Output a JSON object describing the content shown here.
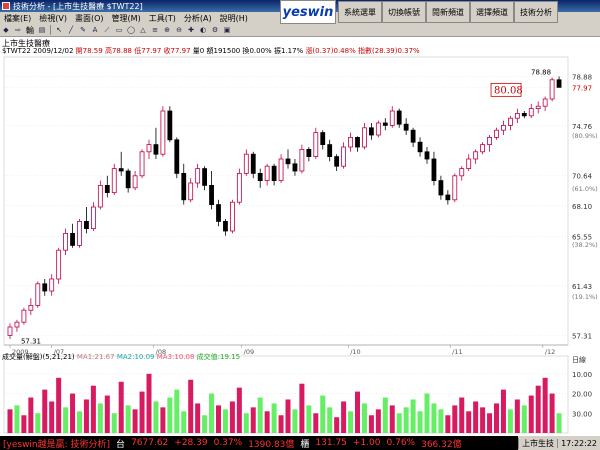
{
  "window": {
    "title": "技術分析 - [上市生技醫療 $TWT22]"
  },
  "menu": [
    "檔案(E)",
    "檢視(V)",
    "畫面(O)",
    "管理(M)",
    "工具(T)",
    "分析(A)",
    "說明(H)"
  ],
  "brand": "yeswin",
  "nav_buttons": [
    "系統選單",
    "切換帳號",
    "閱新頻道",
    "選擇頻道",
    "技術分析"
  ],
  "toolbar": {
    "zoom_label": "輸"
  },
  "stock": {
    "name": "上市生技醫療",
    "code": "$TWT22",
    "date": "2009/12/02",
    "open": "開78.59",
    "high": "高78.88",
    "low": "低77.97",
    "close": "收77.97",
    "volume": "量0",
    "amount": "額191500",
    "turnover": "換0.00%",
    "amplitude": "振1.17%",
    "change": "漲(0.37)0.48%",
    "index": "指數(28.39)0.37%"
  },
  "chart_data": {
    "type": "candlestick",
    "ylim": [
      56.5,
      80.5
    ],
    "y_ticks": [
      78.88,
      77.97,
      74.76,
      70.64,
      68.1,
      65.55,
      61.43,
      57.31
    ],
    "y_tick_labels": [
      "78.88",
      "77.97",
      "74.76",
      "70.64",
      "68.10",
      "65.55",
      "61.43",
      "57.31"
    ],
    "pct_labels": [
      {
        "v": 74.0,
        "t": "(80.9%)"
      },
      {
        "v": 69.6,
        "t": "(61.0%)"
      },
      {
        "v": 64.9,
        "t": "(38.2%)"
      },
      {
        "v": 60.6,
        "t": "(19.1%)"
      }
    ],
    "x_labels": [
      "2009",
      "/07",
      "/08",
      "/09",
      "/10",
      "/11",
      "/12"
    ],
    "x_positions": [
      0,
      18,
      62,
      100,
      146,
      190,
      230
    ],
    "cursor_value": "80.08",
    "min_label": "57.31",
    "max_label": "78.88",
    "last_price_label": "77.97",
    "candles": [
      [
        57.3,
        58.3,
        57.0,
        58.0
      ],
      [
        58.0,
        58.6,
        57.6,
        58.4
      ],
      [
        58.4,
        59.6,
        58.2,
        59.4
      ],
      [
        59.4,
        60.4,
        59.0,
        59.8
      ],
      [
        59.8,
        61.8,
        59.6,
        61.6
      ],
      [
        61.6,
        62.0,
        60.6,
        61.0
      ],
      [
        61.0,
        62.4,
        60.6,
        62.0
      ],
      [
        62.0,
        64.6,
        61.6,
        64.4
      ],
      [
        64.4,
        66.2,
        64.0,
        65.8
      ],
      [
        65.8,
        66.6,
        64.6,
        64.8
      ],
      [
        64.8,
        67.0,
        64.6,
        66.8
      ],
      [
        66.8,
        68.0,
        65.8,
        66.2
      ],
      [
        66.2,
        68.4,
        66.0,
        68.0
      ],
      [
        68.0,
        70.2,
        67.8,
        69.8
      ],
      [
        69.8,
        70.6,
        68.8,
        69.2
      ],
      [
        69.2,
        71.6,
        69.0,
        71.2
      ],
      [
        71.2,
        72.6,
        70.6,
        71.0
      ],
      [
        71.0,
        71.2,
        69.2,
        69.6
      ],
      [
        69.6,
        71.0,
        69.4,
        70.6
      ],
      [
        70.6,
        72.8,
        70.4,
        72.6
      ],
      [
        72.6,
        73.6,
        72.0,
        73.2
      ],
      [
        73.2,
        74.6,
        72.0,
        72.4
      ],
      [
        72.4,
        76.4,
        72.2,
        76.0
      ],
      [
        76.0,
        76.4,
        73.4,
        73.6
      ],
      [
        73.6,
        73.8,
        70.4,
        70.8
      ],
      [
        70.8,
        71.6,
        68.2,
        68.6
      ],
      [
        68.6,
        70.4,
        68.4,
        70.0
      ],
      [
        70.0,
        71.6,
        69.6,
        71.2
      ],
      [
        71.2,
        71.4,
        69.4,
        69.8
      ],
      [
        69.8,
        71.0,
        67.8,
        68.2
      ],
      [
        68.2,
        68.6,
        66.4,
        66.8
      ],
      [
        66.8,
        67.0,
        65.6,
        66.0
      ],
      [
        66.0,
        68.6,
        65.8,
        68.4
      ],
      [
        68.4,
        71.2,
        68.2,
        70.8
      ],
      [
        70.8,
        72.8,
        70.6,
        72.4
      ],
      [
        72.4,
        72.6,
        70.4,
        70.8
      ],
      [
        70.8,
        71.2,
        69.6,
        70.2
      ],
      [
        70.2,
        71.6,
        69.8,
        71.4
      ],
      [
        71.4,
        71.6,
        69.8,
        70.2
      ],
      [
        70.2,
        72.4,
        70.0,
        72.0
      ],
      [
        72.0,
        72.8,
        71.2,
        71.6
      ],
      [
        71.6,
        72.0,
        70.6,
        71.0
      ],
      [
        71.0,
        73.2,
        70.8,
        72.8
      ],
      [
        72.8,
        73.0,
        71.8,
        72.2
      ],
      [
        72.2,
        74.6,
        72.0,
        74.2
      ],
      [
        74.2,
        74.4,
        72.8,
        73.2
      ],
      [
        73.2,
        73.6,
        71.8,
        72.2
      ],
      [
        72.2,
        72.4,
        71.0,
        71.4
      ],
      [
        71.4,
        73.4,
        71.2,
        73.0
      ],
      [
        73.0,
        74.2,
        72.6,
        73.8
      ],
      [
        73.8,
        73.9,
        72.6,
        73.0
      ],
      [
        73.0,
        75.0,
        72.8,
        74.6
      ],
      [
        74.6,
        75.0,
        73.6,
        74.0
      ],
      [
        74.0,
        75.2,
        73.8,
        75.0
      ],
      [
        75.0,
        75.4,
        74.4,
        74.8
      ],
      [
        74.8,
        76.4,
        74.6,
        76.0
      ],
      [
        76.0,
        76.2,
        74.6,
        74.9
      ],
      [
        74.9,
        75.4,
        74.0,
        74.4
      ],
      [
        74.4,
        74.6,
        73.0,
        73.4
      ],
      [
        73.4,
        73.8,
        72.2,
        72.6
      ],
      [
        72.6,
        73.0,
        71.6,
        72.0
      ],
      [
        72.0,
        72.6,
        69.8,
        70.2
      ],
      [
        70.2,
        70.6,
        68.6,
        69.0
      ],
      [
        69.0,
        69.4,
        68.2,
        68.6
      ],
      [
        68.6,
        70.8,
        68.4,
        70.6
      ],
      [
        70.6,
        71.4,
        70.2,
        71.2
      ],
      [
        71.2,
        72.4,
        71.0,
        72.0
      ],
      [
        72.0,
        72.8,
        71.6,
        72.6
      ],
      [
        72.6,
        73.4,
        72.4,
        73.2
      ],
      [
        73.2,
        74.0,
        72.6,
        73.8
      ],
      [
        73.8,
        74.6,
        73.6,
        74.4
      ],
      [
        74.4,
        75.2,
        74.0,
        74.8
      ],
      [
        74.8,
        75.6,
        74.4,
        75.4
      ],
      [
        75.4,
        76.2,
        75.0,
        75.8
      ],
      [
        75.8,
        76.0,
        75.4,
        75.6
      ],
      [
        75.6,
        76.6,
        75.4,
        76.2
      ],
      [
        76.2,
        76.8,
        75.8,
        76.4
      ],
      [
        76.4,
        77.2,
        76.0,
        77.0
      ],
      [
        77.0,
        78.8,
        76.8,
        78.6
      ],
      [
        78.6,
        78.88,
        77.97,
        77.97
      ]
    ],
    "volumes": [
      [
        12,
        1
      ],
      [
        14,
        0
      ],
      [
        9,
        1
      ],
      [
        18,
        1
      ],
      [
        10,
        0
      ],
      [
        22,
        1
      ],
      [
        16,
        1
      ],
      [
        28,
        1
      ],
      [
        13,
        0
      ],
      [
        20,
        1
      ],
      [
        11,
        0
      ],
      [
        17,
        1
      ],
      [
        24,
        1
      ],
      [
        15,
        0
      ],
      [
        19,
        1
      ],
      [
        10,
        0
      ],
      [
        26,
        1
      ],
      [
        14,
        0
      ],
      [
        12,
        1
      ],
      [
        21,
        1
      ],
      [
        30,
        1
      ],
      [
        16,
        0
      ],
      [
        13,
        1
      ],
      [
        18,
        0
      ],
      [
        22,
        0
      ],
      [
        11,
        0
      ],
      [
        27,
        1
      ],
      [
        15,
        1
      ],
      [
        9,
        0
      ],
      [
        20,
        0
      ],
      [
        14,
        1
      ],
      [
        12,
        0
      ],
      [
        16,
        1
      ],
      [
        23,
        1
      ],
      [
        10,
        0
      ],
      [
        13,
        1
      ],
      [
        18,
        0
      ],
      [
        11,
        1
      ],
      [
        15,
        0
      ],
      [
        9,
        1
      ],
      [
        17,
        1
      ],
      [
        12,
        0
      ],
      [
        25,
        1
      ],
      [
        14,
        0
      ],
      [
        10,
        1
      ],
      [
        19,
        0
      ],
      [
        13,
        0
      ],
      [
        8,
        1
      ],
      [
        16,
        1
      ],
      [
        11,
        0
      ],
      [
        21,
        1
      ],
      [
        15,
        0
      ],
      [
        9,
        1
      ],
      [
        12,
        1
      ],
      [
        18,
        0
      ],
      [
        14,
        1
      ],
      [
        10,
        0
      ],
      [
        13,
        0
      ],
      [
        17,
        0
      ],
      [
        11,
        0
      ],
      [
        20,
        0
      ],
      [
        15,
        0
      ],
      [
        12,
        0
      ],
      [
        9,
        1
      ],
      [
        14,
        1
      ],
      [
        18,
        1
      ],
      [
        11,
        1
      ],
      [
        16,
        1
      ],
      [
        13,
        1
      ],
      [
        10,
        1
      ],
      [
        15,
        1
      ],
      [
        22,
        1
      ],
      [
        12,
        0
      ],
      [
        17,
        1
      ],
      [
        14,
        0
      ],
      [
        19,
        1
      ],
      [
        24,
        1
      ],
      [
        28,
        1
      ],
      [
        20,
        1
      ],
      [
        10,
        0
      ]
    ],
    "volume_ylim": [
      0,
      35
    ],
    "volume_ticks": [
      10.0,
      20.0,
      30.0
    ]
  },
  "volume_panel": {
    "title": "成交量(解盤)(5,21,21)",
    "ma1": "MA1:21.67",
    "ma2": "MA2:10.09",
    "ma3": "MA3:10.08",
    "volume_label": "成交值:19.15",
    "right_label": "日線",
    "tick_labels": [
      "30.00",
      "20.00",
      "10.00"
    ]
  },
  "status": {
    "app": "[yeswin越是贏: 技術分析]",
    "tw_label": "台",
    "tw_index": "7677.62",
    "tw_change": "+28.39",
    "tw_pct": "0.37%",
    "tw_amount": "1390.83億",
    "otc_label": "櫃",
    "otc_index": "131.75",
    "otc_change": "+1.00",
    "otc_pct": "0.76%",
    "otc_amount": "366.32億",
    "tray_item": "上市生技",
    "clock": "17:22:22"
  },
  "colors": {
    "up": "#c0004a",
    "down": "#000000",
    "vol_up": "#d81b60",
    "vol_down": "#66ee66"
  }
}
